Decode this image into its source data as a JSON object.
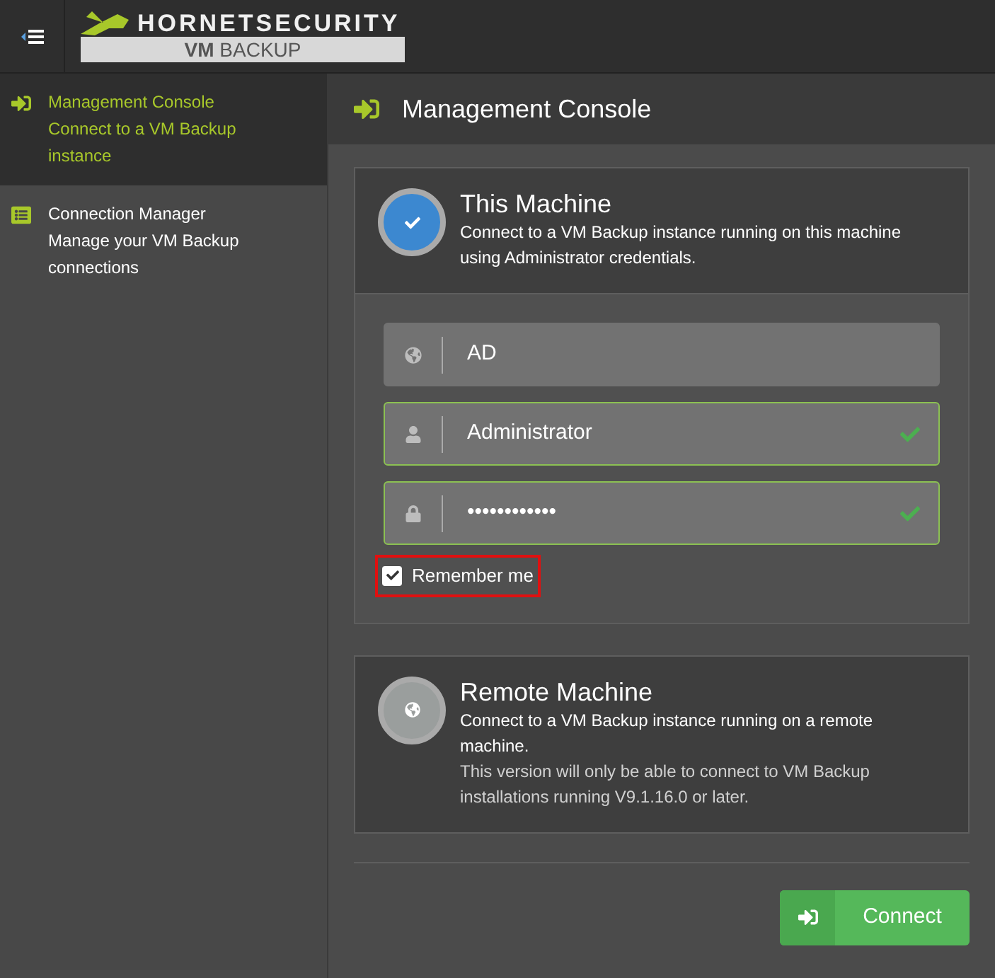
{
  "logo": {
    "brand": "HORNETSECURITY",
    "product_bold": "VM",
    "product": "BACKUP"
  },
  "sidebar": {
    "items": [
      {
        "kind": "sign-in",
        "title": "Management Console",
        "subtitle": "Connect to a VM Backup instance",
        "selected": true
      },
      {
        "kind": "list",
        "title": "Connection Manager",
        "subtitle": "Manage your VM Backup connections",
        "selected": false
      }
    ]
  },
  "page": {
    "title": "Management Console"
  },
  "machines": [
    {
      "title": "This Machine",
      "description": [
        "Connect to a VM Backup instance running on this machine using Administrator credentials."
      ],
      "selected": true,
      "form": {
        "fields": [
          {
            "kind": "globe",
            "value": "AD",
            "valid": false
          },
          {
            "kind": "user",
            "value": "Administrator",
            "valid": true
          },
          {
            "kind": "lock",
            "value": "••••••••••••",
            "valid": true
          }
        ],
        "remember": {
          "label": "Remember me",
          "checked": true,
          "highlighted": true
        }
      }
    },
    {
      "title": "Remote Machine",
      "description": [
        "Connect to a VM Backup instance running on a remote machine.",
        "This version will only be able to connect to VM Backup installations running V9.1.16.0 or later."
      ],
      "selected": false
    }
  ],
  "connect_button": {
    "label": "Connect"
  }
}
